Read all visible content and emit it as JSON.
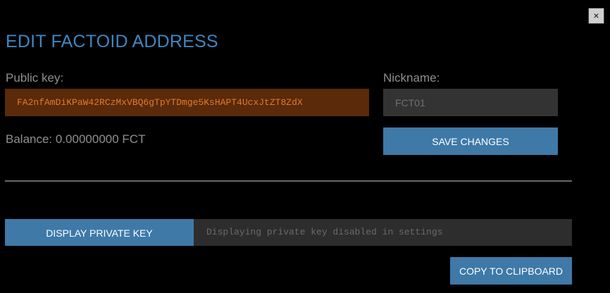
{
  "dialog": {
    "close_label": "×",
    "title": "EDIT FACTOID ADDRESS"
  },
  "public_key": {
    "label": "Public key:",
    "value": "FA2nfAmDiKPaW42RCzMxVBQ6gTpYTDmge5KsHAPT4UcxJtZT8ZdX"
  },
  "balance": {
    "text": "Balance: 0.00000000 FCT"
  },
  "nickname": {
    "label": "Nickname:",
    "placeholder": "FCT01"
  },
  "actions": {
    "save_label": "SAVE CHANGES",
    "display_private_key_label": "DISPLAY PRIVATE KEY",
    "private_key_message": "Displaying private key disabled in settings",
    "copy_label": "COPY TO CLIPBOARD"
  },
  "colors": {
    "accent": "#3e79a8",
    "title": "#3f86c1",
    "public_key_bg": "#5a2a0a",
    "public_key_text": "#e07a30",
    "background": "#000000"
  }
}
